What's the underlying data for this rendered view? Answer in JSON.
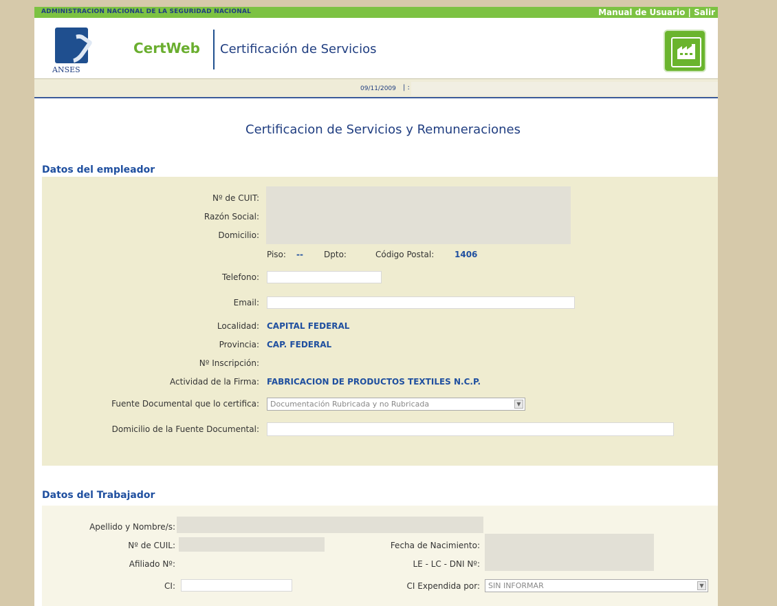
{
  "topbar": {
    "org": "ADMINISTRACION NACIONAL DE LA SEGURIDAD NACIONAL",
    "links": [
      {
        "label": "Manual de Usuario"
      },
      {
        "label": "Salir"
      }
    ],
    "separator": "|"
  },
  "header": {
    "logo_text": "ANSES",
    "brand": "CertWeb",
    "subtitle": "Certificación de Servicios"
  },
  "datebar": {
    "date": "09/11/2009",
    "separator": "| :"
  },
  "main": {
    "title": "Certificacion de Servicios y Remuneraciones"
  },
  "employer": {
    "section_title": "Datos del empleador",
    "cuit_label": "Nº de CUIT:",
    "razon_label": "Razón Social:",
    "domicilio_label": "Domicilio:",
    "piso_label": "Piso:",
    "piso_value": "--",
    "dpto_label": "Dpto:",
    "cp_label": "Código Postal:",
    "cp_value": "1406",
    "telefono_label": "Telefono:",
    "email_label": "Email:",
    "localidad_label": "Localidad:",
    "localidad_value": "CAPITAL FEDERAL",
    "provincia_label": "Provincia:",
    "provincia_value": "CAP. FEDERAL",
    "inscripcion_label": "Nº Inscripción:",
    "actividad_label": "Actividad de la Firma:",
    "actividad_value": "FABRICACION DE PRODUCTOS TEXTILES N.C.P.",
    "fuente_label": "Fuente Documental que lo certifica:",
    "fuente_value": "Documentación Rubricada y no Rubricada",
    "domicilio_fuente_label": "Domicilio de la Fuente Documental:"
  },
  "worker": {
    "section_title": "Datos del Trabajador",
    "nombre_label": "Apellido y Nombre/s:",
    "cuil_label": "Nº de CUIL:",
    "nacimiento_label": "Fecha de Nacimiento:",
    "afiliado_label": "Afiliado Nº:",
    "dni_label": "LE - LC - DNI Nº:",
    "ci_label": "CI:",
    "ci_expedida_label": "CI Expendida por:",
    "ci_expedida_value": "SIN INFORMAR"
  },
  "colors": {
    "green": "#7cc242",
    "navy": "#1f3d80",
    "panel": "#efecd0"
  }
}
